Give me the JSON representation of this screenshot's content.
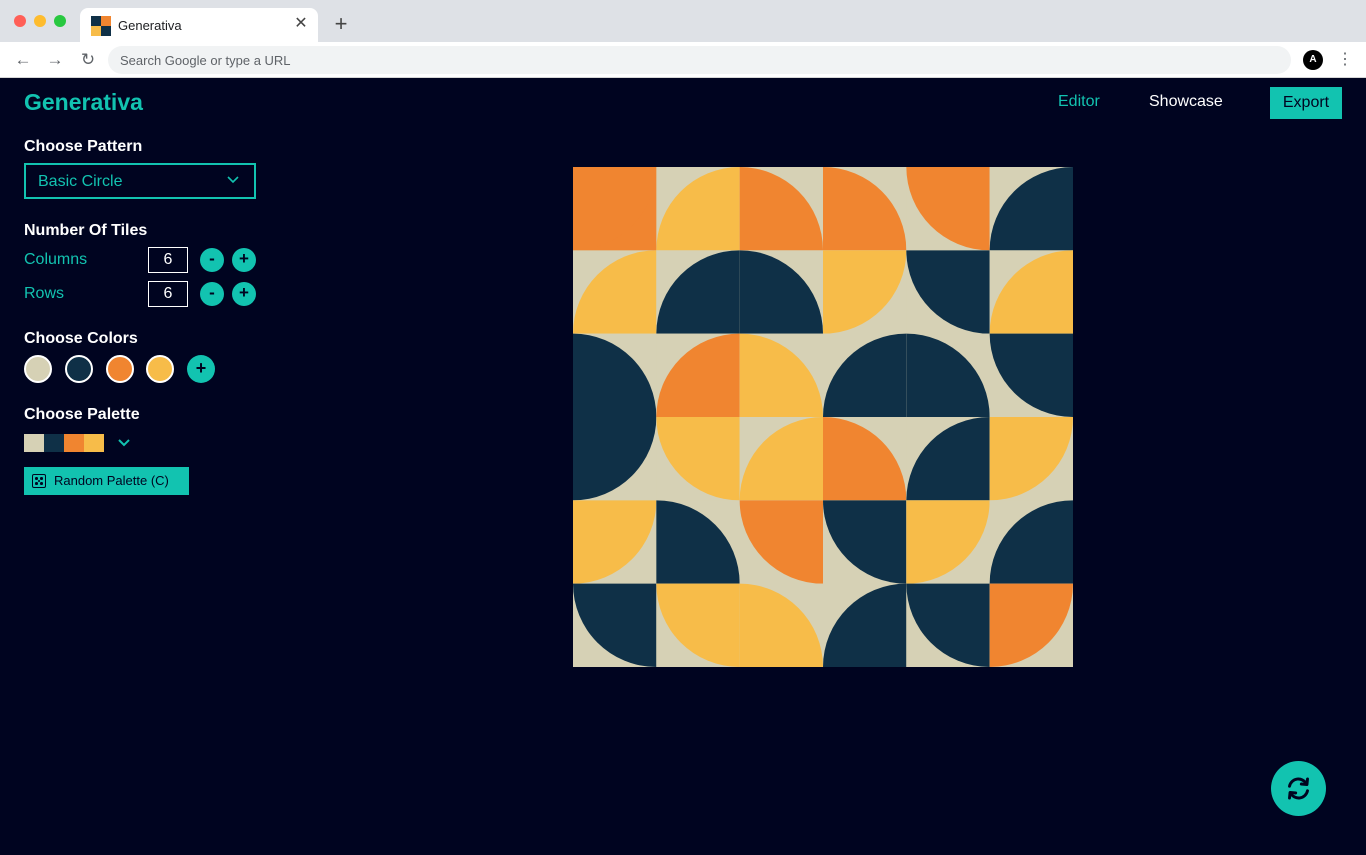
{
  "browser": {
    "tab_title": "Generativa",
    "tab_close": "✕",
    "new_tab": "+",
    "omnibox_placeholder": "Search Google or type a URL",
    "profile_initial": "A",
    "nav_back": "←",
    "nav_forward": "→",
    "nav_reload": "↻",
    "menu": "⋮"
  },
  "header": {
    "logo": "Generativa",
    "nav_editor": "Editor",
    "nav_showcase": "Showcase",
    "export_label": "Export"
  },
  "sidebar": {
    "pattern_title": "Choose Pattern",
    "pattern_value": "Basic Circle",
    "tiles_title": "Number Of Tiles",
    "columns_label": "Columns",
    "columns_value": "6",
    "rows_label": "Rows",
    "rows_value": "6",
    "decrement": "-",
    "increment": "+",
    "colors_title": "Choose Colors",
    "add_color": "+",
    "palette_title": "Choose Palette",
    "random_label": "Random Palette (C)"
  },
  "colors": {
    "accent": "#12c3b0",
    "background": "#000420",
    "palette": [
      "#d6d1b5",
      "#0f3047",
      "#f08530",
      "#f7bc49"
    ]
  },
  "canvas": {
    "pattern": "basic-circle",
    "columns": 6,
    "rows": 6,
    "tiles": [
      [
        {
          "bg": 2,
          "fg": 2,
          "shape": "q",
          "corner": "tl"
        },
        {
          "bg": 0,
          "fg": 3,
          "shape": "q",
          "corner": "br"
        },
        {
          "bg": 0,
          "fg": 2,
          "shape": "q",
          "corner": "bl"
        },
        {
          "bg": 0,
          "fg": 2,
          "shape": "q",
          "corner": "bl"
        },
        {
          "bg": 0,
          "fg": 2,
          "shape": "q",
          "corner": "tr"
        },
        {
          "bg": 0,
          "fg": 1,
          "shape": "q",
          "corner": "br"
        }
      ],
      [
        {
          "bg": 0,
          "fg": 3,
          "shape": "q",
          "corner": "br"
        },
        {
          "bg": 0,
          "fg": 1,
          "shape": "q",
          "corner": "br"
        },
        {
          "bg": 0,
          "fg": 1,
          "shape": "q",
          "corner": "bl"
        },
        {
          "bg": 0,
          "fg": 3,
          "shape": "q",
          "corner": "tl"
        },
        {
          "bg": 0,
          "fg": 1,
          "shape": "q",
          "corner": "tr"
        },
        {
          "bg": 0,
          "fg": 3,
          "shape": "q",
          "corner": "br"
        }
      ],
      [
        {
          "bg": 0,
          "fg": 1,
          "shape": "q",
          "corner": "bl"
        },
        {
          "bg": 0,
          "fg": 2,
          "shape": "q",
          "corner": "br"
        },
        {
          "bg": 0,
          "fg": 3,
          "shape": "q",
          "corner": "bl"
        },
        {
          "bg": 0,
          "fg": 1,
          "shape": "q",
          "corner": "br"
        },
        {
          "bg": 0,
          "fg": 1,
          "shape": "q",
          "corner": "bl"
        },
        {
          "bg": 0,
          "fg": 1,
          "shape": "q",
          "corner": "tr"
        }
      ],
      [
        {
          "bg": 0,
          "fg": 1,
          "shape": "q",
          "corner": "tl"
        },
        {
          "bg": 0,
          "fg": 3,
          "shape": "q",
          "corner": "tr"
        },
        {
          "bg": 0,
          "fg": 3,
          "shape": "q",
          "corner": "br"
        },
        {
          "bg": 0,
          "fg": 2,
          "shape": "q",
          "corner": "bl"
        },
        {
          "bg": 0,
          "fg": 1,
          "shape": "q",
          "corner": "br"
        },
        {
          "bg": 0,
          "fg": 3,
          "shape": "q",
          "corner": "tl"
        }
      ],
      [
        {
          "bg": 0,
          "fg": 3,
          "shape": "q",
          "corner": "tl"
        },
        {
          "bg": 0,
          "fg": 1,
          "shape": "q",
          "corner": "bl"
        },
        {
          "bg": 0,
          "fg": 2,
          "shape": "q",
          "corner": "tr"
        },
        {
          "bg": 0,
          "fg": 1,
          "shape": "q",
          "corner": "tr"
        },
        {
          "bg": 0,
          "fg": 3,
          "shape": "q",
          "corner": "tl"
        },
        {
          "bg": 0,
          "fg": 1,
          "shape": "q",
          "corner": "br"
        }
      ],
      [
        {
          "bg": 0,
          "fg": 1,
          "shape": "q",
          "corner": "tr"
        },
        {
          "bg": 0,
          "fg": 3,
          "shape": "q",
          "corner": "tr"
        },
        {
          "bg": 0,
          "fg": 3,
          "shape": "q",
          "corner": "bl"
        },
        {
          "bg": 0,
          "fg": 1,
          "shape": "q",
          "corner": "br"
        },
        {
          "bg": 0,
          "fg": 1,
          "shape": "q",
          "corner": "tr"
        },
        {
          "bg": 0,
          "fg": 2,
          "shape": "q",
          "corner": "tl"
        }
      ]
    ]
  }
}
